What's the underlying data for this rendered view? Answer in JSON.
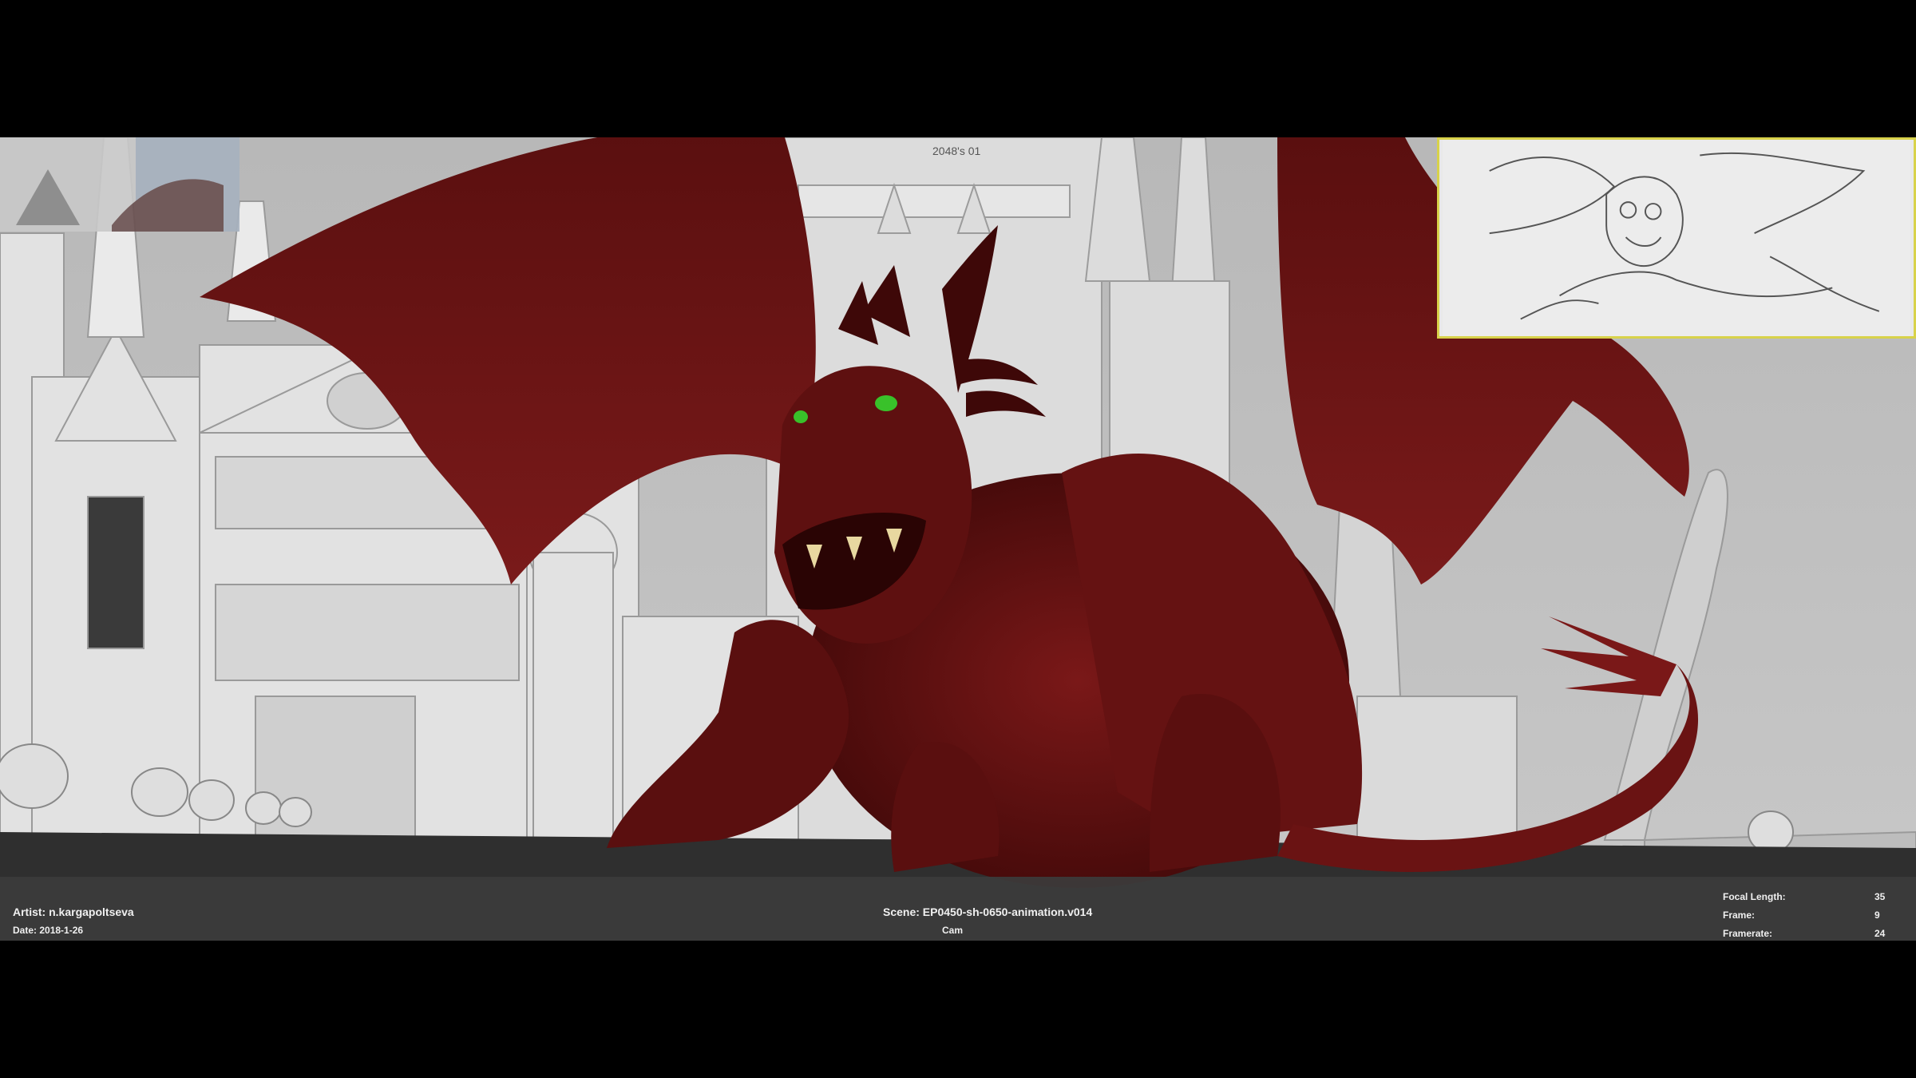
{
  "hud": {
    "artist_label": "Artist: n.kargapoltseva",
    "date_label": "Date: 2018-1-26",
    "scene_label": "Scene: EP0450-sh-0650-animation.v014",
    "camera_label": "Cam",
    "stats": [
      {
        "label": "Focal Length:",
        "value": "35"
      },
      {
        "label": "Frame:",
        "value": "9"
      },
      {
        "label": "Framerate:",
        "value": "24"
      }
    ]
  },
  "viewport": {
    "building_label": "2048's 01"
  },
  "colors": {
    "dragon": "#6e1414",
    "dragon_dark": "#3e0808",
    "buildings": "#d9d9d9",
    "ground": "#2f2f2f",
    "hud_bg": "#3c3c3c",
    "storyboard_border": "#d8d24a",
    "eye": "#39c12a"
  }
}
